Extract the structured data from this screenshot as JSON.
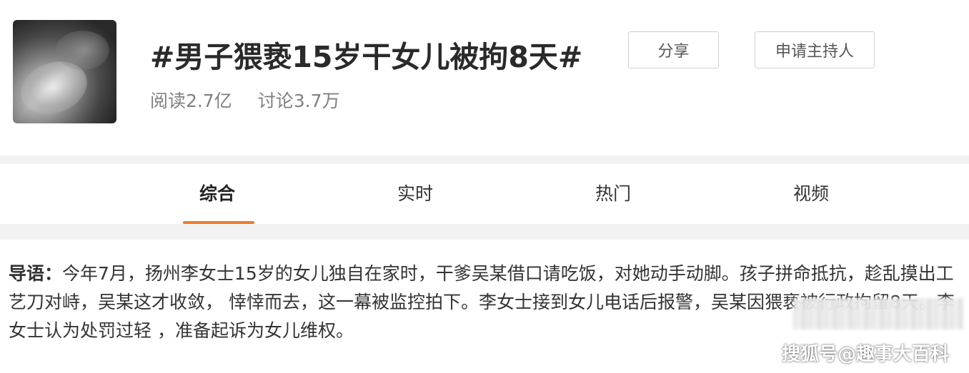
{
  "topic": {
    "title": "#男子猥亵15岁干女儿被拘8天#",
    "reads": "阅读2.7亿",
    "discussions": "讨论3.7万",
    "share_label": "分享",
    "apply_host_label": "申请主持人"
  },
  "tabs": [
    {
      "label": "综合",
      "active": true
    },
    {
      "label": "实时",
      "active": false
    },
    {
      "label": "热门",
      "active": false
    },
    {
      "label": "视频",
      "active": false
    }
  ],
  "guide": {
    "label": "导语：",
    "text": "今年7月，扬州李女士15岁的女儿独自在家时，干爹吴某借口请吃饭，对她动手动脚。孩子拼命抵抗，趁乱摸出工艺刀对峙，吴某这才收敛， 悻悻而去，这一幕被监控拍下。李女士接到女儿电话后报警，吴某因猥亵被行政拘留8天。李女士认为处罚过轻 ，准备起诉为女儿维权。"
  },
  "watermark": "搜狐号@趣事大百科",
  "colors": {
    "accent": "#ef7a2d",
    "title": "#2a2a2a",
    "muted": "#808080"
  }
}
